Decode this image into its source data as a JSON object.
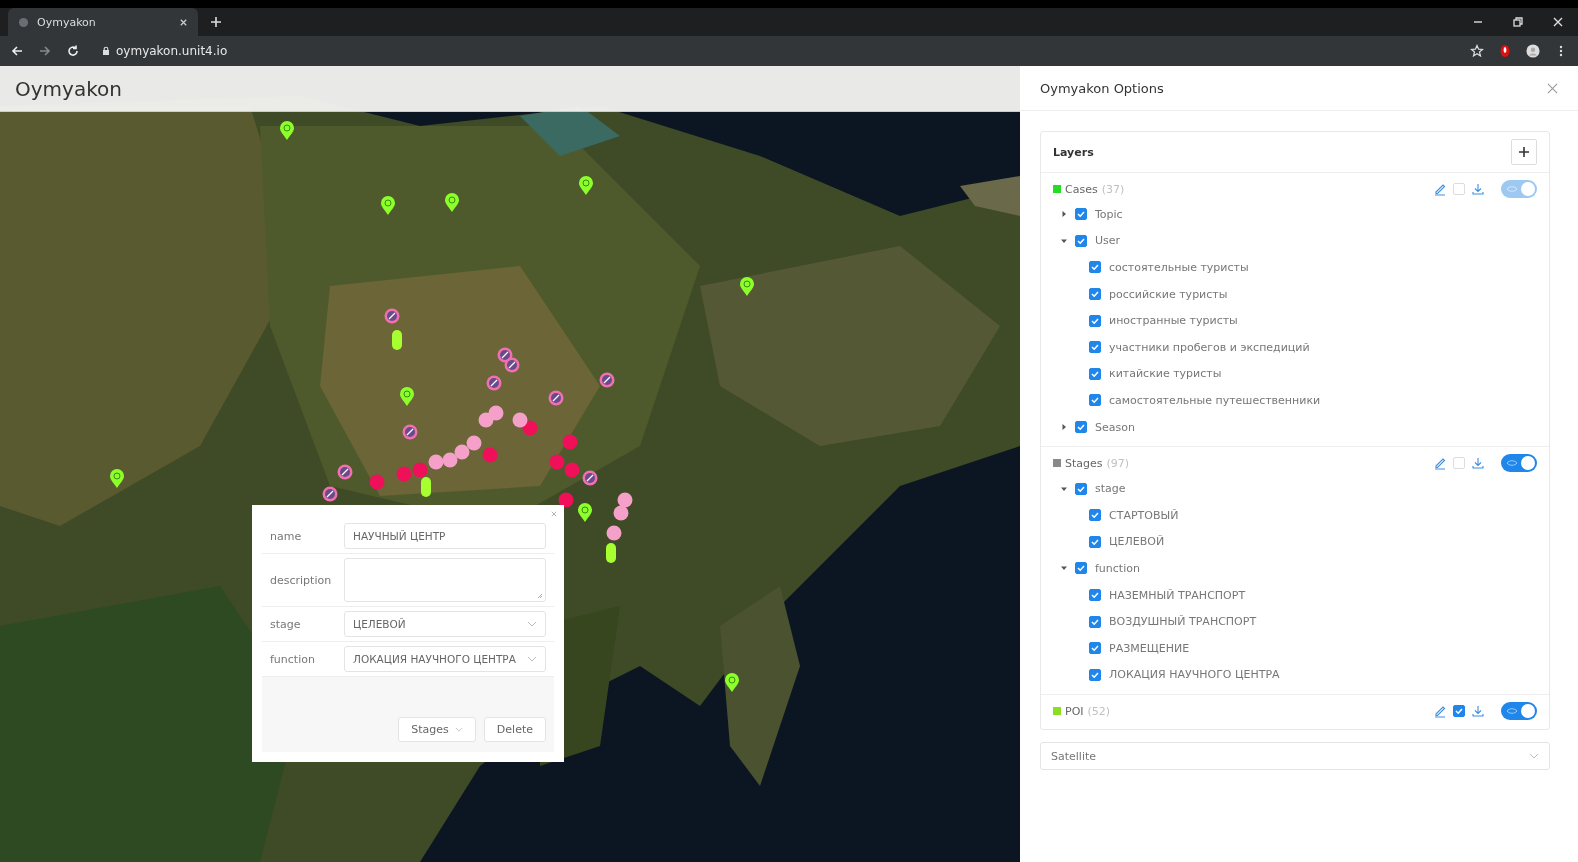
{
  "browser": {
    "tab_title": "Oymyakon",
    "url": "oymyakon.unit4.io"
  },
  "app": {
    "title": "Oymyakon"
  },
  "popup": {
    "fields": [
      {
        "label": "name",
        "kind": "input",
        "value": "НАУЧНЫЙ ЦЕНТР"
      },
      {
        "label": "description",
        "kind": "textarea"
      },
      {
        "label": "stage",
        "kind": "select",
        "value": "ЦЕЛЕВОЙ"
      },
      {
        "label": "function",
        "kind": "select",
        "value": "ЛОКАЦИЯ НАУЧНОГО ЦЕНТРА"
      }
    ],
    "buttons": [
      {
        "label": "Stages",
        "kind": "dropdown"
      },
      {
        "label": "Delete",
        "kind": "plain"
      }
    ]
  },
  "panel": {
    "title": "Oymyakon Options",
    "layers_title": "Layers",
    "layers": [
      {
        "name": "Cases",
        "count": "(37)",
        "color": "#22dd22",
        "checked": false,
        "on": true,
        "disabled": true,
        "children": [
          {
            "label": "Topic",
            "checked": true,
            "expanded": false
          },
          {
            "label": "User",
            "checked": true,
            "expanded": true,
            "children": [
              {
                "label": "состоятельные туристы",
                "checked": true
              },
              {
                "label": "российские туристы",
                "checked": true
              },
              {
                "label": "иностранные туристы",
                "checked": true
              },
              {
                "label": "участники пробегов и экспедиций",
                "checked": true
              },
              {
                "label": "китайские туристы",
                "checked": true
              },
              {
                "label": "самостоятельные путешественники",
                "checked": true
              }
            ]
          },
          {
            "label": "Season",
            "checked": true,
            "expanded": false
          }
        ]
      },
      {
        "name": "Stages",
        "count": "(97)",
        "color": "#888888",
        "checked": false,
        "on": true,
        "disabled": false,
        "children": [
          {
            "label": "stage",
            "checked": true,
            "expanded": true,
            "children": [
              {
                "label": "СТАРТОВЫЙ",
                "checked": true
              },
              {
                "label": "ЦЕЛЕВОЙ",
                "checked": true
              }
            ]
          },
          {
            "label": "function",
            "checked": true,
            "expanded": true,
            "children": [
              {
                "label": "НАЗЕМНЫЙ ТРАНСПОРТ",
                "checked": true
              },
              {
                "label": "ВОЗДУШНЫЙ ТРАНСПОРТ",
                "checked": true
              },
              {
                "label": "РАЗМЕЩЕНИЕ",
                "checked": true
              },
              {
                "label": "ЛОКАЦИЯ НАУЧНОГО ЦЕНТРА",
                "checked": true
              }
            ]
          }
        ]
      },
      {
        "name": "POI",
        "count": "(52)",
        "color": "#88e020",
        "checked": true,
        "on": true,
        "disabled": false
      }
    ],
    "basemap": "Satellite"
  }
}
